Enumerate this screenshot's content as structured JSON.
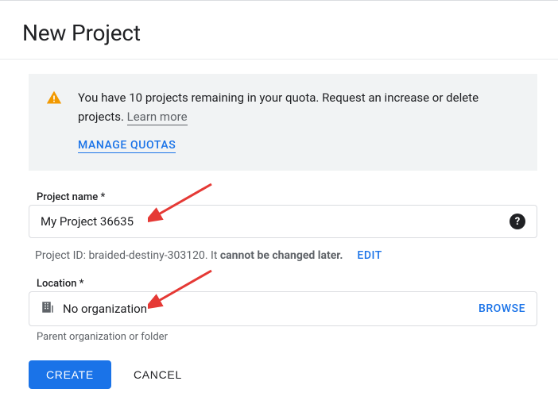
{
  "header": {
    "title": "New Project"
  },
  "notice": {
    "text_pre": "You have 10 projects remaining in your quota. Request an increase or delete projects. ",
    "learn_more_label": "Learn more",
    "manage_quotas_label": "MANAGE QUOTAS"
  },
  "project_name": {
    "label": "Project name *",
    "value": "My Project 36635"
  },
  "project_id": {
    "prefix": "Project ID: ",
    "id": "braided-destiny-303120",
    "period": ". It ",
    "bold_text": "cannot be changed later.",
    "edit_label": "EDIT"
  },
  "location": {
    "label": "Location *",
    "value": "No organization",
    "browse_label": "BROWSE",
    "helper": "Parent organization or folder"
  },
  "buttons": {
    "create": "CREATE",
    "cancel": "CANCEL"
  }
}
